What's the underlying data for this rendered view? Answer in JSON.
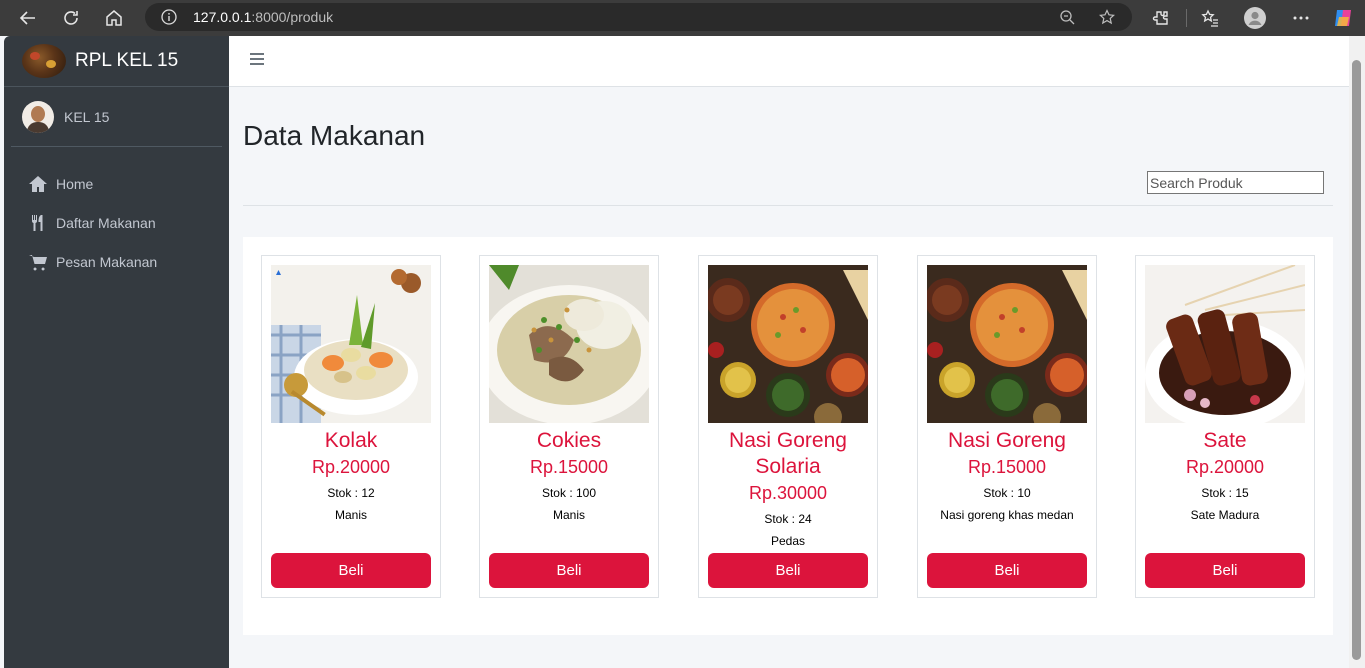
{
  "browser": {
    "url_host": "127.0.0.1",
    "url_rest": ":8000/produk"
  },
  "sidebar": {
    "brand": "RPL KEL 15",
    "user": "KEL 15",
    "items": [
      {
        "label": "Home",
        "icon": "home-icon"
      },
      {
        "label": "Daftar Makanan",
        "icon": "utensils-icon"
      },
      {
        "label": "Pesan Makanan",
        "icon": "cart-icon"
      }
    ]
  },
  "main": {
    "title": "Data Makanan",
    "search_placeholder": "Search Produk",
    "buy_label": "Beli",
    "products": [
      {
        "name": "Kolak",
        "price": "Rp.20000",
        "stock": "Stok : 12",
        "desc": "Manis",
        "image": "kolak-dish"
      },
      {
        "name": "Cokies",
        "price": "Rp.15000",
        "stock": "Stok : 100",
        "desc": "Manis",
        "image": "soup-dish"
      },
      {
        "name": "Nasi Goreng Solaria",
        "price": "Rp.30000",
        "stock": "Stok : 24",
        "desc": "Pedas",
        "image": "fried-rice-spread"
      },
      {
        "name": "Nasi Goreng",
        "price": "Rp.15000",
        "stock": "Stok : 10",
        "desc": "Nasi goreng khas medan",
        "image": "fried-rice-spread"
      },
      {
        "name": "Sate",
        "price": "Rp.20000",
        "stock": "Stok : 15",
        "desc": "Sate Madura",
        "image": "sate-skewers"
      }
    ]
  }
}
